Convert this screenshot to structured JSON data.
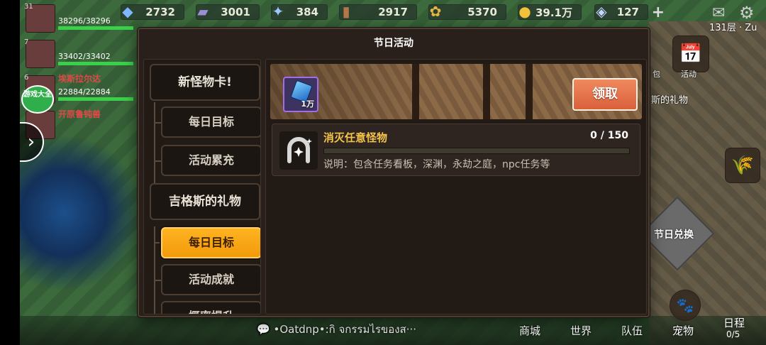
{
  "resources": [
    {
      "icon": "crystal-icon",
      "value": "2732",
      "width": 90
    },
    {
      "icon": "book-icon",
      "value": "3001",
      "width": 90
    },
    {
      "icon": "ore-icon",
      "value": "384",
      "width": 80
    },
    {
      "icon": "wood-icon",
      "value": "2917",
      "width": 110
    },
    {
      "icon": "wheat-icon",
      "value": "5370",
      "width": 110
    },
    {
      "icon": "gold-coin-icon",
      "value": "39.1万",
      "width": 90
    },
    {
      "icon": "gem-icon",
      "value": "127",
      "width": 88
    }
  ],
  "party": [
    {
      "level": "31",
      "name": "",
      "hp": "38296/38296",
      "hp_pct": 100
    },
    {
      "level": "7",
      "name": "",
      "hp": "33402/33402",
      "hp_pct": 100
    },
    {
      "level": "6",
      "name": "埃斯拉尔达",
      "hp": "22884/22884",
      "hp_pct": 100
    },
    {
      "level": "",
      "name": "开原鲁钝兽",
      "hp": "",
      "hp_pct": 0
    }
  ],
  "chat_button": {
    "label": "游戏大全"
  },
  "floor_label": "131层 · Zu",
  "side_labels": {
    "bag": "包",
    "activity": "活动",
    "gift": "斯的礼物",
    "exchange": "节日兑换"
  },
  "modal": {
    "title": "节日活动",
    "categories": [
      {
        "label": "新怪物卡!"
      },
      {
        "label": "吉格斯的礼物"
      }
    ],
    "subs_group1": [
      {
        "label": "每日目标"
      },
      {
        "label": "活动累充"
      }
    ],
    "subs_group2": [
      {
        "label": "每日目标"
      },
      {
        "label": "活动成就"
      },
      {
        "label": "概率提升"
      }
    ],
    "reward": {
      "quantity": "1万"
    },
    "claim_label": "领取",
    "task": {
      "name": "消灭任意怪物",
      "progress": "0 / 150",
      "progress_fraction": 0.0,
      "description": "说明：包含任务看板，深渊，永劫之庭，npc任务等"
    }
  },
  "chat_line": "•Oatdnp•:กิ จกรรมไรของส···",
  "bottom_nav": [
    {
      "label": "商城"
    },
    {
      "label": "世界"
    },
    {
      "label": "队伍"
    },
    {
      "label": "宠物"
    },
    {
      "label": "日程"
    }
  ],
  "schedule_count": "0/5"
}
